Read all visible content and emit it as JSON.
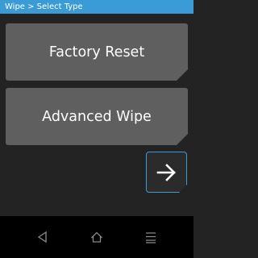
{
  "header": {
    "title": "Wipe > Select Type"
  },
  "buttons": {
    "factory_reset": "Factory Reset",
    "advanced_wipe": "Advanced Wipe"
  },
  "icons": {
    "next": "arrow-right-icon",
    "back": "back-triangle-icon",
    "home": "home-icon",
    "menu": "menu-icon"
  },
  "colors": {
    "accent": "#3b9bd6",
    "button": "#5f5f5f",
    "background": "#232323",
    "nav_bar": "#000000"
  }
}
